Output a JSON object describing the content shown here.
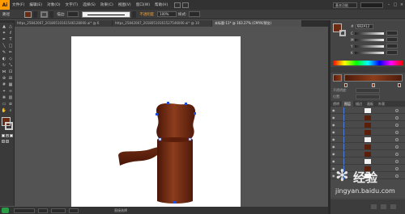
{
  "app": {
    "logo": "Ai"
  },
  "menubar": {
    "items": [
      "文件(F)",
      "编辑(E)",
      "对象(O)",
      "文字(T)",
      "选择(S)",
      "效果(C)",
      "视图(V)",
      "窗口(W)",
      "帮助(H)"
    ],
    "workspace": "基本功能"
  },
  "control_bar": {
    "label": "路径",
    "fill_color": "#6b2a12",
    "stroke_label": "描边:",
    "style_link": "不透明度",
    "opacity_value": "100%",
    "style_label": "样式:"
  },
  "tabs": [
    {
      "label": "https_2584206​7_20180510161546128000.ai* @ 6",
      "active": false
    },
    {
      "label": "https_25842067_20180510161527546000.ai* @ 10",
      "active": false
    },
    {
      "label": "未标题-11* @ 163.27% (CMYK/预览)",
      "active": true
    }
  ],
  "color_panel": {
    "fill": "#6b2a12",
    "hex": "6B2A12",
    "sliders": [
      "C",
      "M",
      "Y",
      "K"
    ]
  },
  "gradient_panel": {
    "type_label": "类型:",
    "options": [
      "不透明度:",
      "位置:"
    ]
  },
  "layers_panel": {
    "tabs": [
      "透明",
      "图层",
      "描边",
      "画板",
      "外观"
    ]
  },
  "status_bar": {
    "zoom": "163.27%",
    "tool": "直接选择"
  },
  "watermark": {
    "text": "经验",
    "url": "jingyan.baidu.com"
  },
  "colors": {
    "art_fill": "#6b2a12",
    "art_dark": "#4a1608",
    "art_light": "#8c3d1d"
  }
}
